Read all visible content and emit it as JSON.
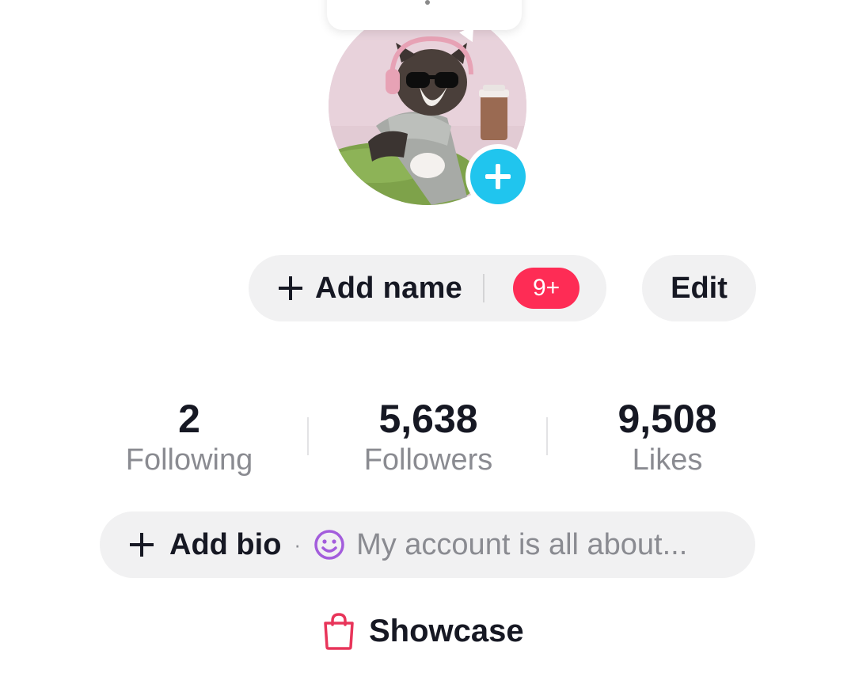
{
  "profile": {
    "avatar_icon": "cat-avatar-photo",
    "add_avatar_icon": "plus-icon",
    "add_name_label": "Add name",
    "badge_text": "9+",
    "edit_label": "Edit"
  },
  "stats": [
    {
      "value": "2",
      "label": "Following"
    },
    {
      "value": "5,638",
      "label": "Followers"
    },
    {
      "value": "9,508",
      "label": "Likes"
    }
  ],
  "bio": {
    "add_bio_label": "Add bio",
    "separator": "·",
    "placeholder": "My account is all about..."
  },
  "showcase": {
    "label": "Showcase",
    "icon": "shopping-bag-icon"
  },
  "colors": {
    "accent_cyan": "#20c5ee",
    "badge_red": "#fe2c55",
    "showcase_bag": "#e8355a",
    "smile_purple": "#a35ddc",
    "pill_bg": "#f1f1f2"
  }
}
